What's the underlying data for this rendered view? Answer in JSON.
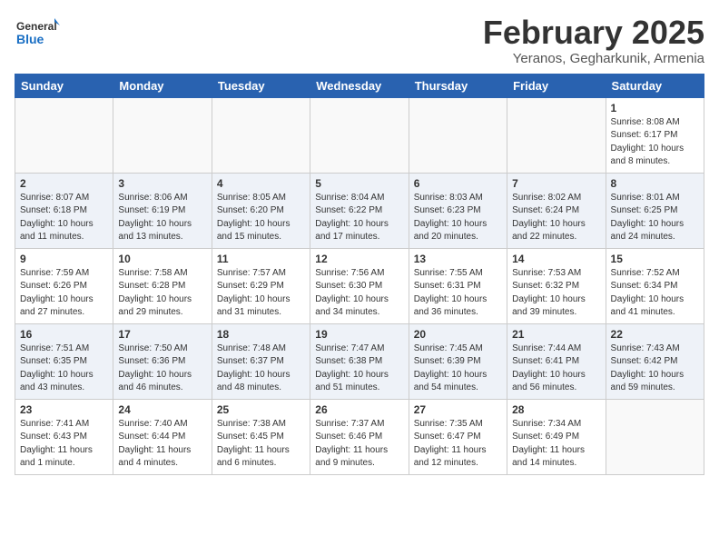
{
  "header": {
    "logo_general": "General",
    "logo_blue": "Blue",
    "month_title": "February 2025",
    "location": "Yeranos, Gegharkunik, Armenia"
  },
  "days_of_week": [
    "Sunday",
    "Monday",
    "Tuesday",
    "Wednesday",
    "Thursday",
    "Friday",
    "Saturday"
  ],
  "weeks": [
    [
      {
        "day": "",
        "info": ""
      },
      {
        "day": "",
        "info": ""
      },
      {
        "day": "",
        "info": ""
      },
      {
        "day": "",
        "info": ""
      },
      {
        "day": "",
        "info": ""
      },
      {
        "day": "",
        "info": ""
      },
      {
        "day": "1",
        "info": "Sunrise: 8:08 AM\nSunset: 6:17 PM\nDaylight: 10 hours and 8 minutes."
      }
    ],
    [
      {
        "day": "2",
        "info": "Sunrise: 8:07 AM\nSunset: 6:18 PM\nDaylight: 10 hours and 11 minutes."
      },
      {
        "day": "3",
        "info": "Sunrise: 8:06 AM\nSunset: 6:19 PM\nDaylight: 10 hours and 13 minutes."
      },
      {
        "day": "4",
        "info": "Sunrise: 8:05 AM\nSunset: 6:20 PM\nDaylight: 10 hours and 15 minutes."
      },
      {
        "day": "5",
        "info": "Sunrise: 8:04 AM\nSunset: 6:22 PM\nDaylight: 10 hours and 17 minutes."
      },
      {
        "day": "6",
        "info": "Sunrise: 8:03 AM\nSunset: 6:23 PM\nDaylight: 10 hours and 20 minutes."
      },
      {
        "day": "7",
        "info": "Sunrise: 8:02 AM\nSunset: 6:24 PM\nDaylight: 10 hours and 22 minutes."
      },
      {
        "day": "8",
        "info": "Sunrise: 8:01 AM\nSunset: 6:25 PM\nDaylight: 10 hours and 24 minutes."
      }
    ],
    [
      {
        "day": "9",
        "info": "Sunrise: 7:59 AM\nSunset: 6:26 PM\nDaylight: 10 hours and 27 minutes."
      },
      {
        "day": "10",
        "info": "Sunrise: 7:58 AM\nSunset: 6:28 PM\nDaylight: 10 hours and 29 minutes."
      },
      {
        "day": "11",
        "info": "Sunrise: 7:57 AM\nSunset: 6:29 PM\nDaylight: 10 hours and 31 minutes."
      },
      {
        "day": "12",
        "info": "Sunrise: 7:56 AM\nSunset: 6:30 PM\nDaylight: 10 hours and 34 minutes."
      },
      {
        "day": "13",
        "info": "Sunrise: 7:55 AM\nSunset: 6:31 PM\nDaylight: 10 hours and 36 minutes."
      },
      {
        "day": "14",
        "info": "Sunrise: 7:53 AM\nSunset: 6:32 PM\nDaylight: 10 hours and 39 minutes."
      },
      {
        "day": "15",
        "info": "Sunrise: 7:52 AM\nSunset: 6:34 PM\nDaylight: 10 hours and 41 minutes."
      }
    ],
    [
      {
        "day": "16",
        "info": "Sunrise: 7:51 AM\nSunset: 6:35 PM\nDaylight: 10 hours and 43 minutes."
      },
      {
        "day": "17",
        "info": "Sunrise: 7:50 AM\nSunset: 6:36 PM\nDaylight: 10 hours and 46 minutes."
      },
      {
        "day": "18",
        "info": "Sunrise: 7:48 AM\nSunset: 6:37 PM\nDaylight: 10 hours and 48 minutes."
      },
      {
        "day": "19",
        "info": "Sunrise: 7:47 AM\nSunset: 6:38 PM\nDaylight: 10 hours and 51 minutes."
      },
      {
        "day": "20",
        "info": "Sunrise: 7:45 AM\nSunset: 6:39 PM\nDaylight: 10 hours and 54 minutes."
      },
      {
        "day": "21",
        "info": "Sunrise: 7:44 AM\nSunset: 6:41 PM\nDaylight: 10 hours and 56 minutes."
      },
      {
        "day": "22",
        "info": "Sunrise: 7:43 AM\nSunset: 6:42 PM\nDaylight: 10 hours and 59 minutes."
      }
    ],
    [
      {
        "day": "23",
        "info": "Sunrise: 7:41 AM\nSunset: 6:43 PM\nDaylight: 11 hours and 1 minute."
      },
      {
        "day": "24",
        "info": "Sunrise: 7:40 AM\nSunset: 6:44 PM\nDaylight: 11 hours and 4 minutes."
      },
      {
        "day": "25",
        "info": "Sunrise: 7:38 AM\nSunset: 6:45 PM\nDaylight: 11 hours and 6 minutes."
      },
      {
        "day": "26",
        "info": "Sunrise: 7:37 AM\nSunset: 6:46 PM\nDaylight: 11 hours and 9 minutes."
      },
      {
        "day": "27",
        "info": "Sunrise: 7:35 AM\nSunset: 6:47 PM\nDaylight: 11 hours and 12 minutes."
      },
      {
        "day": "28",
        "info": "Sunrise: 7:34 AM\nSunset: 6:49 PM\nDaylight: 11 hours and 14 minutes."
      },
      {
        "day": "",
        "info": ""
      }
    ]
  ]
}
